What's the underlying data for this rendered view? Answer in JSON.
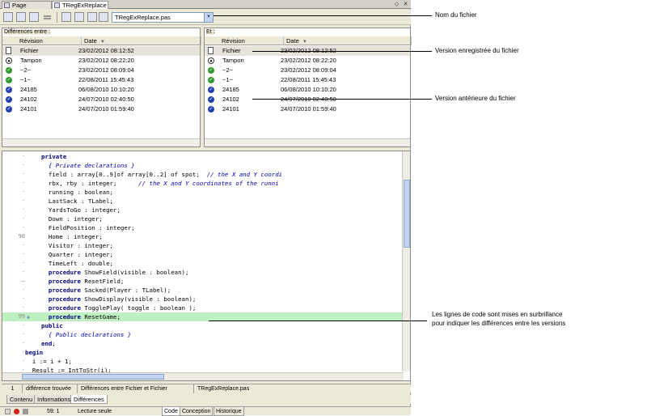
{
  "tabs": [
    {
      "label": "Page d'accueil"
    },
    {
      "label": "TRegExReplace"
    }
  ],
  "window_buttons": [
    "◇",
    "✕"
  ],
  "toolbar": {
    "file_combo_value": "TRegExReplace.pas"
  },
  "left_panel": {
    "title": "Différences entre :",
    "col_revision": "Révision",
    "col_date": "Date",
    "rows": [
      {
        "icon": "page-icon",
        "revision": "Fichier",
        "date": "23/02/2012 08:12:52"
      },
      {
        "icon": "eye-icon",
        "revision": "Tampon",
        "date": "23/02/2012 08:22:20"
      },
      {
        "icon": "green-revision-icon",
        "revision": "~2~",
        "date": "23/02/2012 08:09:04"
      },
      {
        "icon": "green-revision-icon",
        "revision": "~1~",
        "date": "22/08/2011 15:45:43"
      },
      {
        "icon": "blue-check-icon",
        "revision": "24185",
        "date": "06/08/2010 10:10:20"
      },
      {
        "icon": "blue-check-icon",
        "revision": "24102",
        "date": "24/07/2010 02:40:50"
      },
      {
        "icon": "blue-check-icon",
        "revision": "24101",
        "date": "24/07/2010 01:59:40"
      }
    ]
  },
  "right_panel": {
    "title": "Et :",
    "col_revision": "Révision",
    "col_date": "Date",
    "rows": [
      {
        "icon": "page-icon",
        "revision": "Fichier",
        "date": "23/02/2012 08:12:52"
      },
      {
        "icon": "eye-icon",
        "revision": "Tampon",
        "date": "23/02/2012 08:22:20"
      },
      {
        "icon": "green-revision-icon",
        "revision": "~2~",
        "date": "23/02/2012 08:09:04"
      },
      {
        "icon": "green-revision-icon",
        "revision": "~1~",
        "date": "22/08/2011 15:45:43"
      },
      {
        "icon": "blue-check-icon",
        "revision": "24185",
        "date": "06/08/2010 10:10:20"
      },
      {
        "icon": "blue-check-icon",
        "revision": "24102",
        "date": "24/07/2010 02:40:50"
      },
      {
        "icon": "blue-check-icon",
        "revision": "24101",
        "date": "24/07/2010 01:59:40"
      }
    ]
  },
  "code": {
    "lines": [
      {
        "num": "·",
        "kw": "private",
        "text": "",
        "comment": ""
      },
      {
        "num": "·",
        "kw": "",
        "text": "  ",
        "comment": "{ Private declarations }"
      },
      {
        "num": "·",
        "kw": "",
        "text": "  field : array[0..9]of array[0..2] of spot;  ",
        "comment": "// the X and Y coordi"
      },
      {
        "num": "·",
        "kw": "",
        "text": "  rbx, rby : integer;      ",
        "comment": "// the X and Y coordinates of the runni"
      },
      {
        "num": "·",
        "kw": "",
        "text": "  running : boolean;",
        "comment": ""
      },
      {
        "num": "·",
        "kw": "",
        "text": "  LastSack : TLabel;",
        "comment": ""
      },
      {
        "num": "·",
        "kw": "",
        "text": "  YardsToGo : integer;",
        "comment": ""
      },
      {
        "num": "·",
        "kw": "",
        "text": "  Down : integer;",
        "comment": ""
      },
      {
        "num": "·",
        "kw": "",
        "text": "  FieldPosition : integer;",
        "comment": ""
      },
      {
        "num": "90",
        "kw": "",
        "text": "  Home : integer;",
        "comment": ""
      },
      {
        "num": "·",
        "kw": "",
        "text": "  Visitor : integer;",
        "comment": ""
      },
      {
        "num": "·",
        "kw": "",
        "text": "  Quarter : integer;",
        "comment": ""
      },
      {
        "num": "·",
        "kw": "",
        "text": "  TimeLeft : double;",
        "comment": ""
      },
      {
        "num": "·",
        "kw": "  procedure",
        "text": " ShowField(visible : boolean);",
        "comment": ""
      },
      {
        "num": "–",
        "kw": "  procedure",
        "text": " ResetField;",
        "comment": ""
      },
      {
        "num": "·",
        "kw": "  procedure",
        "text": " Sacked(Player : TLabel);",
        "comment": ""
      },
      {
        "num": "·",
        "kw": "  procedure",
        "text": " ShowDisplay(visible : boolean);",
        "comment": ""
      },
      {
        "num": "·",
        "kw": "  procedure",
        "text": " TogglePlay( toggle : boolean );",
        "comment": ""
      },
      {
        "num": "99",
        "kw": "  procedure",
        "text": " ResetGame;",
        "comment": "",
        "highlight": true
      },
      {
        "num": "·",
        "kw": "public",
        "text": "",
        "comment": ""
      },
      {
        "num": "·",
        "kw": "",
        "text": "  ",
        "comment": "{ Public declarations }"
      },
      {
        "num": "·",
        "kw": "end",
        "text": ";",
        "comment": ""
      },
      {
        "num": "·",
        "kw": "begin",
        "text": "",
        "comment": "",
        "outdent": true
      },
      {
        "num": "·",
        "kw": "",
        "text": "  i := i + 1;",
        "comment": "",
        "outdent": true
      },
      {
        "num": "·",
        "kw": "",
        "text": "  Result := IntToStr(i);",
        "comment": "",
        "outdent": true
      }
    ]
  },
  "status": {
    "count": "1",
    "found": "différence trouvée",
    "between": "Différences entre Fichier et Fichier",
    "file": "TRegExReplace.pas"
  },
  "bottom_tabs": [
    "Contenu",
    "Informations",
    "Différences"
  ],
  "footer": {
    "position": "59:    1",
    "mode": "Lecture seule",
    "tabs": [
      "Code",
      "Conception",
      "Historique"
    ]
  },
  "annotations": {
    "file_name": "Nom du fichier",
    "saved_version": "Version enregistrée du fichier",
    "previous_version": "Version antérieure du fichier",
    "highlight_note_1": "Les lignes de code sont mises en surbrillance",
    "highlight_note_2": "pour indiquer les différences entre les versions"
  },
  "colors": {
    "highlight_green": "#bff0bf",
    "keyword": "#000080",
    "comment": "#0000b0",
    "green_icon": "#2e9a2e",
    "blue_icon": "#2040b0"
  }
}
